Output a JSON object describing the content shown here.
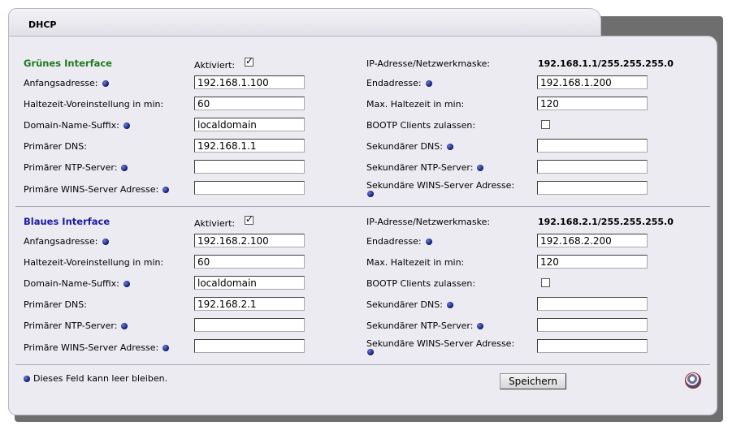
{
  "window": {
    "tab_title": "DHCP"
  },
  "labels": {
    "activated": "Aktiviert:",
    "ip_mask": "IP-Adresse/Netzwerkmaske:",
    "start": "Anfangsadresse:",
    "end": "Endadresse:",
    "default_lease": "Haltezeit-Voreinstellung in min:",
    "max_lease": "Max. Haltezeit in min:",
    "domain_suffix": "Domain-Name-Suffix:",
    "bootp": "BOOTP Clients zulassen:",
    "dns1": "Primärer DNS:",
    "dns2": "Sekundärer DNS:",
    "ntp1": "Primärer NTP-Server:",
    "ntp2": "Sekundärer NTP-Server:",
    "wins1": "Primäre WINS-Server Adresse:",
    "wins2": "Sekundäre WINS-Server Adresse:"
  },
  "green": {
    "title": "Grünes Interface",
    "title_color": "#1f7a1f",
    "activated": true,
    "ip_mask": "192.168.1.1/255.255.255.0",
    "start": "192.168.1.100",
    "end": "192.168.1.200",
    "default_lease": "60",
    "max_lease": "120",
    "domain_suffix": "localdomain",
    "bootp": false,
    "dns1": "192.168.1.1",
    "dns2": "",
    "ntp1": "",
    "ntp2": "",
    "wins1": "",
    "wins2": ""
  },
  "blue": {
    "title": "Blaues Interface",
    "title_color": "#1a1aa6",
    "activated": true,
    "ip_mask": "192.168.2.1/255.255.255.0",
    "start": "192.168.2.100",
    "end": "192.168.2.200",
    "default_lease": "60",
    "max_lease": "120",
    "domain_suffix": "localdomain",
    "bootp": false,
    "dns1": "192.168.2.1",
    "dns2": "",
    "ntp1": "",
    "ntp2": "",
    "wins1": "",
    "wins2": ""
  },
  "footer": {
    "note": "Dieses Feld kann leer bleiben.",
    "save_label": "Speichern",
    "help_icon": "lifebuoy-icon"
  },
  "checkmark": "✓",
  "colors": {
    "panel_bg": "#ecebf2",
    "required_dot": "#0a1668"
  }
}
